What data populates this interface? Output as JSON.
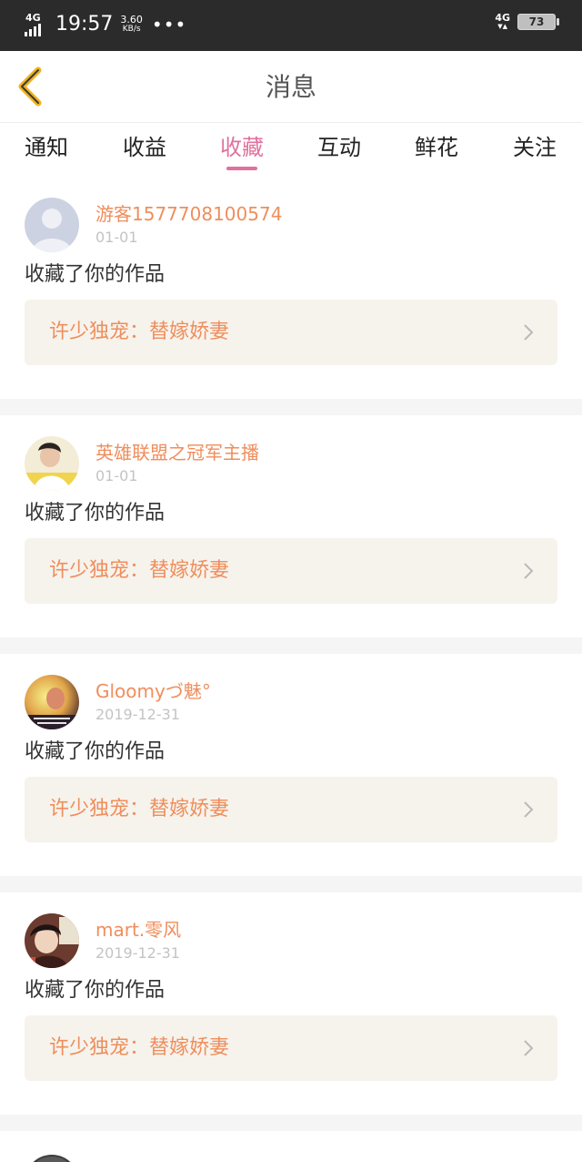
{
  "status_bar": {
    "network_left": "4G",
    "time": "19:57",
    "speed_value": "3.60",
    "speed_unit": "KB/s",
    "more_dots": "•••",
    "network_right": "4G",
    "battery": "73"
  },
  "header": {
    "back_icon": "chevron-left-icon",
    "title": "消息",
    "accent_color": "#e1709e",
    "back_color": "#f2b21b"
  },
  "tabs": [
    {
      "label": "通知"
    },
    {
      "label": "收益"
    },
    {
      "label": "收藏",
      "active": true
    },
    {
      "label": "互动"
    },
    {
      "label": "鲜花"
    },
    {
      "label": "关注"
    }
  ],
  "items": [
    {
      "username": "游客1577708100574",
      "date": "01-01",
      "action": "收藏了你的作品",
      "work_title": "许少独宠：替嫁娇妻"
    },
    {
      "username": "英雄联盟之冠军主播",
      "date": "01-01",
      "action": "收藏了你的作品",
      "work_title": "许少独宠：替嫁娇妻"
    },
    {
      "username": "Gloomyづ魅°",
      "date": "2019-12-31",
      "action": "收藏了你的作品",
      "work_title": "许少独宠：替嫁娇妻"
    },
    {
      "username": "mart.零风",
      "date": "2019-12-31",
      "action": "收藏了你的作品",
      "work_title": "许少独宠：替嫁娇妻"
    }
  ]
}
